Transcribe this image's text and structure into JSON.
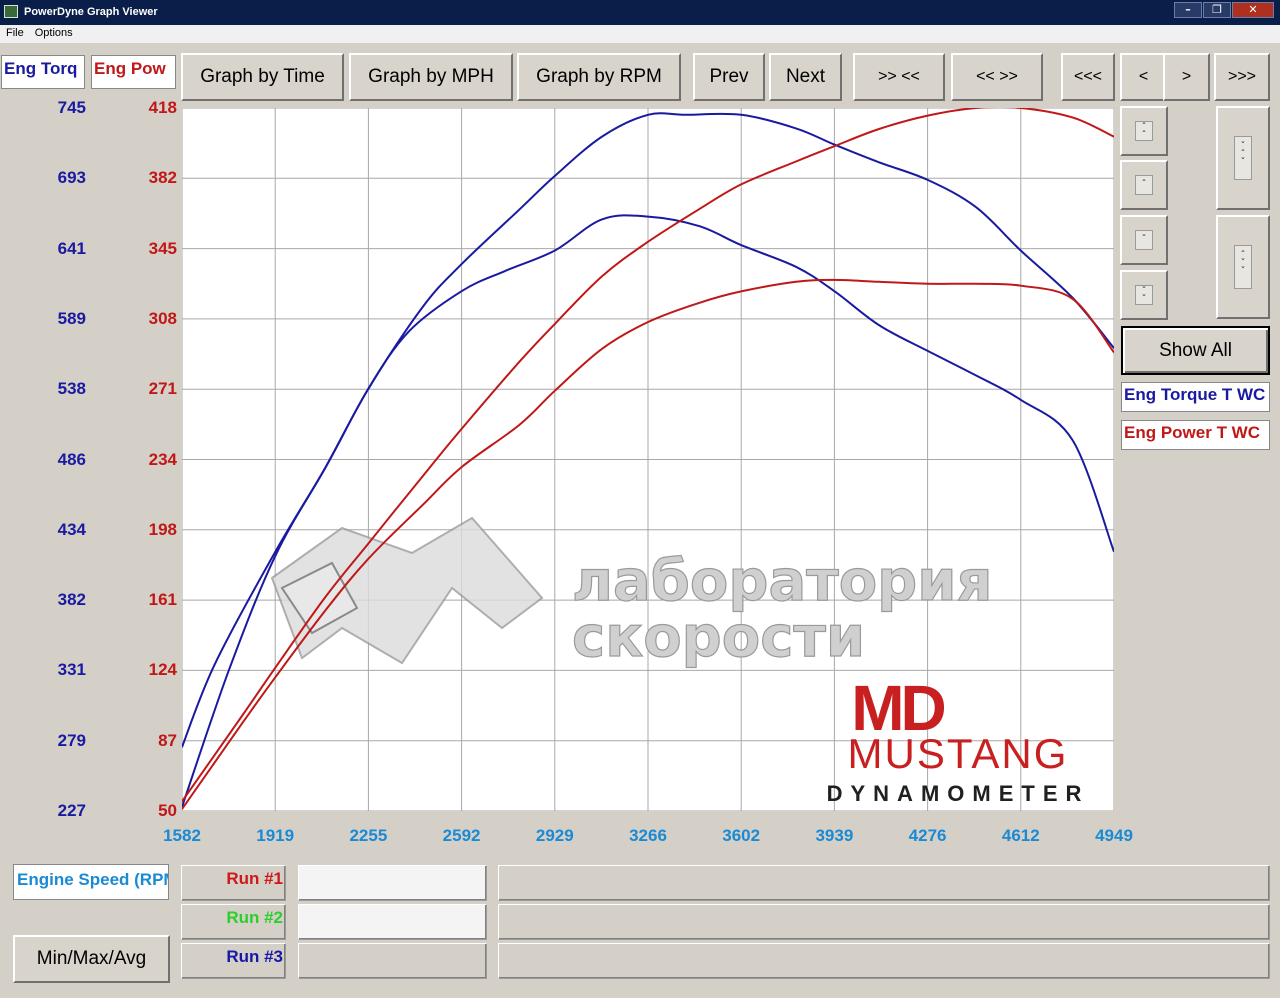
{
  "window": {
    "title": "PowerDyne Graph Viewer",
    "min_label": "–",
    "max_label": "❐",
    "close_label": "✕"
  },
  "menu": {
    "file": "File",
    "options": "Options"
  },
  "tabs": {
    "torque": "Eng Torq",
    "power": "Eng Pow"
  },
  "toolbar": {
    "graph_by_time": "Graph by Time",
    "graph_by_mph": "Graph by MPH",
    "graph_by_rpm": "Graph by RPM",
    "prev": "Prev",
    "next": "Next",
    "zoom_in": ">> <<",
    "zoom_out": "<< >>",
    "first": "<<<",
    "back": "<",
    "forward": ">",
    "last": ">>>"
  },
  "right_panel": {
    "show_all": "Show All",
    "legend_torque": "Eng Torque T WC",
    "legend_power": "Eng Power T WC"
  },
  "bottom": {
    "x_channel": "Engine Speed (RPM)",
    "min_max_avg": "Min/Max/Avg",
    "runs": [
      {
        "label": "Run #1",
        "color": "#d01818"
      },
      {
        "label": "Run #2",
        "color": "#2ad02a"
      },
      {
        "label": "Run #3",
        "color": "#1818a8"
      }
    ]
  },
  "watermark": {
    "line1": "лаборатория",
    "line2": "скорости",
    "logo_mark": "MD",
    "brand": "MUSTANG",
    "brand_sub": "DYNAMOMETER"
  },
  "colors": {
    "torque": "#1a1aa0",
    "power": "#c01818",
    "x_axis_labels": "#1a8ad4"
  },
  "chart_data": {
    "type": "line",
    "title": "",
    "xlabel": "Engine Speed (RPM)",
    "x_ticks": [
      1582,
      1919,
      2255,
      2592,
      2929,
      3266,
      3602,
      3939,
      4276,
      4612,
      4949
    ],
    "xlim": [
      1582,
      4949
    ],
    "y_left": {
      "label": "Eng Torque T WC",
      "ticks": [
        745,
        693,
        641,
        589,
        538,
        486,
        434,
        382,
        331,
        279,
        227
      ],
      "ylim": [
        227,
        745
      ]
    },
    "y_right": {
      "label": "Eng Power T WC",
      "ticks": [
        418,
        382,
        345,
        308,
        271,
        234,
        198,
        161,
        124,
        87,
        50
      ],
      "ylim": [
        50,
        418
      ]
    },
    "grid": true,
    "series": [
      {
        "name": "Eng Torque T WC",
        "axis": "left",
        "color": "#1a1aa0",
        "x": [
          1582,
          1700,
          1919,
          2100,
          2255,
          2450,
          2592,
          2800,
          2929,
          3100,
          3266,
          3400,
          3602,
          3800,
          3939,
          4100,
          4276,
          4450,
          4612,
          4800,
          4949
        ],
        "y": [
          274,
          335,
          418,
          480,
          538,
          598,
          630,
          670,
          695,
          724,
          740,
          740,
          740,
          730,
          718,
          705,
          692,
          672,
          640,
          605,
          568
        ]
      },
      {
        "name": "Eng Torque T WC",
        "axis": "left",
        "color": "#1a1aa0",
        "x": [
          1582,
          1750,
          1919,
          2100,
          2255,
          2400,
          2592,
          2750,
          2929,
          3100,
          3266,
          3450,
          3602,
          3800,
          3939,
          4100,
          4276,
          4450,
          4612,
          4800,
          4949
        ],
        "y": [
          230,
          330,
          415,
          480,
          538,
          580,
          610,
          625,
          640,
          663,
          665,
          658,
          644,
          628,
          610,
          585,
          566,
          548,
          530,
          500,
          418
        ]
      },
      {
        "name": "Eng Power T WC",
        "axis": "right",
        "color": "#c01818",
        "x": [
          1582,
          1800,
          1919,
          2100,
          2255,
          2450,
          2592,
          2800,
          2929,
          3100,
          3266,
          3450,
          3602,
          3800,
          3939,
          4100,
          4276,
          4450,
          4612,
          4800,
          4949
        ],
        "y": [
          55,
          100,
          125,
          162,
          190,
          225,
          250,
          285,
          305,
          330,
          348,
          365,
          378,
          390,
          398,
          407,
          414,
          418,
          418,
          413,
          403
        ]
      },
      {
        "name": "Eng Power T WC",
        "axis": "right",
        "color": "#c01818",
        "x": [
          1582,
          1800,
          1919,
          2100,
          2255,
          2450,
          2592,
          2800,
          2929,
          3100,
          3266,
          3450,
          3602,
          3800,
          3939,
          4100,
          4276,
          4450,
          4612,
          4800,
          4949
        ],
        "y": [
          51,
          96,
          120,
          155,
          182,
          210,
          230,
          252,
          270,
          292,
          306,
          316,
          322,
          327,
          328,
          327,
          326,
          326,
          325,
          318,
          290
        ]
      }
    ]
  }
}
